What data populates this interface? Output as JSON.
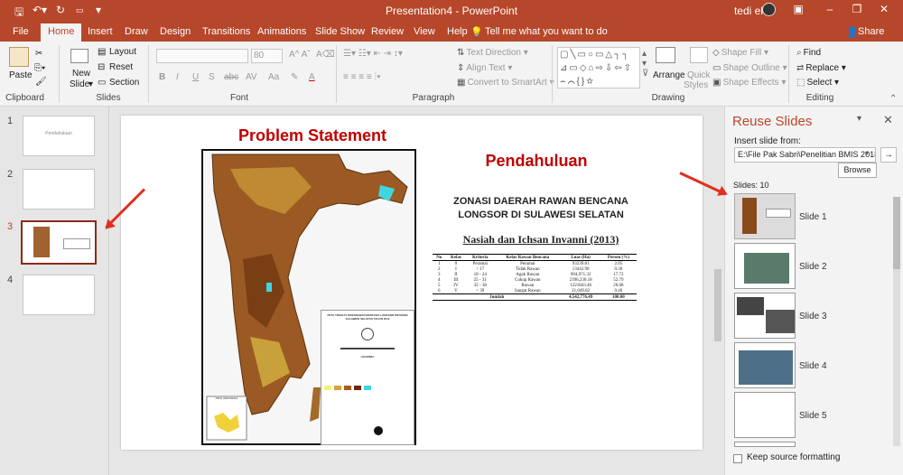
{
  "window": {
    "title": "Presentation4  -  PowerPoint",
    "user": "tedi eka",
    "brand_color": "#b7472a"
  },
  "tabs": [
    {
      "label": "File"
    },
    {
      "label": "Home",
      "active": true
    },
    {
      "label": "Insert"
    },
    {
      "label": "Draw"
    },
    {
      "label": "Design"
    },
    {
      "label": "Transitions"
    },
    {
      "label": "Animations"
    },
    {
      "label": "Slide Show"
    },
    {
      "label": "Review"
    },
    {
      "label": "View"
    },
    {
      "label": "Help"
    }
  ],
  "tell_me": "Tell me what you want to do",
  "share": "Share",
  "ribbon": {
    "clipboard": {
      "paste": "Paste",
      "label": "Clipboard"
    },
    "slides": {
      "new_slide_1": "New",
      "new_slide_2": "Slide",
      "layout": "Layout",
      "reset": "Reset",
      "section": "Section",
      "label": "Slides"
    },
    "font": {
      "size": "80",
      "label": "Font",
      "bold": "B",
      "italic": "I",
      "underline": "U",
      "strike": "S",
      "abc": "abc",
      "shadow": "AV",
      "aa": "Aa",
      "color": "A"
    },
    "paragraph": {
      "text_direction": "Text Direction",
      "align_text": "Align Text",
      "smartart": "Convert to SmartArt",
      "label": "Paragraph"
    },
    "drawing": {
      "arrange": "Arrange",
      "quick_1": "Quick",
      "quick_2": "Styles",
      "shape_fill": "Shape Fill",
      "shape_outline": "Shape Outline",
      "shape_effects": "Shape Effects",
      "label": "Drawing"
    },
    "editing": {
      "find": "Find",
      "replace": "Replace",
      "select": "Select",
      "label": "Editing"
    }
  },
  "thumbnails": [
    {
      "num": "1",
      "text": "Pendahuluan"
    },
    {
      "num": "2",
      "text": ""
    },
    {
      "num": "3",
      "text": "",
      "selected": true
    },
    {
      "num": "4",
      "text": ""
    }
  ],
  "slide": {
    "problem_title": "Problem Statement",
    "pendahuluan": "Pendahuluan",
    "zonasi_1": "ZONASI  DAERAH RAWAN BENCANA",
    "zonasi_2": "LONGSOR DI SULAWESI SELATAN",
    "author": "Nasiah dan Ichsan Invanni (2013)",
    "map_legend_title": "PETA TINGKAT KERAWANAN BENCANA LONGSOR PROVINSI SULAWESI SELATAN TAHUN 2013",
    "map_legend_header": "LEGENDA",
    "map_inset_title": "PETA INDONESIA",
    "table": {
      "headers": [
        "No",
        "Kelas",
        "Kriteria",
        "Kelas Rawan Bencana",
        "Luas (Ha)",
        "Persen (%)"
      ],
      "rows": [
        [
          "1",
          "0",
          "Peramai",
          "Peramai",
          "93239.81",
          "2.05"
        ],
        [
          "2",
          "I",
          "< 17",
          "Tidak Rawan",
          "13442.90",
          "0.30"
        ],
        [
          "3",
          "II",
          "18 - 24",
          "Agak Rawan",
          "904,971.32",
          "17.72"
        ],
        [
          "4",
          "III",
          "25 - 31",
          "Cukup Rawan",
          "2396,230.18",
          "52.79"
        ],
        [
          "5",
          "IV",
          "32 - 38",
          "Rawan",
          "1221843.46",
          "26.68"
        ],
        [
          "6",
          "V",
          "> 39",
          "Sangat Rawan",
          "21,049.82",
          "0.46"
        ]
      ],
      "total_label": "Jumlah",
      "total_area": "4,542,776.49",
      "total_pct": "100.00"
    }
  },
  "reuse": {
    "title": "Reuse Slides",
    "insert_from": "Insert slide from:",
    "path": "E:\\File Pak Sabri\\Penelitian BMIS 2018\\",
    "browse": "Browse",
    "slides_count": "Slides: 10",
    "items": [
      {
        "label": "Slide 1"
      },
      {
        "label": "Slide 2"
      },
      {
        "label": "Slide 3"
      },
      {
        "label": "Slide 4"
      },
      {
        "label": "Slide 5"
      }
    ],
    "keep_formatting": "Keep source formatting"
  }
}
